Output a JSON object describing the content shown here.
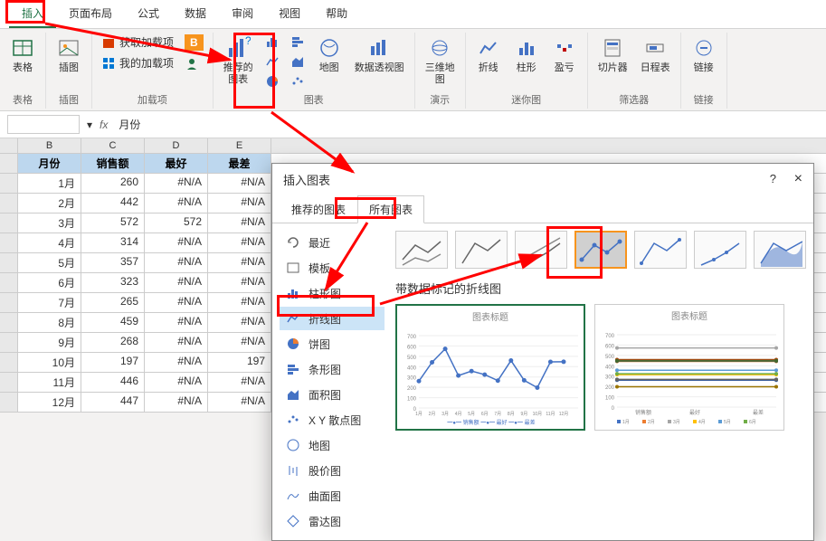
{
  "ribbon": {
    "tabs": [
      "插入",
      "页面布局",
      "公式",
      "数据",
      "审阅",
      "视图",
      "帮助"
    ],
    "active_tab": 0,
    "groups": {
      "tables": {
        "label": "表格",
        "btn": "表格"
      },
      "illustrations": {
        "label": "插图",
        "btn": "插图"
      },
      "addins": {
        "label": "加载项",
        "get": "获取加载项",
        "my": "我的加载项",
        "bing": "B"
      },
      "charts": {
        "label": "图表",
        "recommended": "推荐的\n图表",
        "map": "地图",
        "pivot": "数据透视图"
      },
      "tours": {
        "label": "演示",
        "btn": "三维地\n图"
      },
      "sparklines": {
        "label": "迷你图",
        "line": "折线",
        "column": "柱形",
        "winloss": "盈亏"
      },
      "filters": {
        "label": "筛选器",
        "slicer": "切片器",
        "timeline": "日程表"
      },
      "links": {
        "label": "链接",
        "link": "链接"
      }
    }
  },
  "formula_bar": {
    "fx": "fx",
    "value": "月份"
  },
  "sheet": {
    "cols": [
      "",
      "B",
      "C",
      "D",
      "E"
    ],
    "header_row": [
      "月份",
      "销售额",
      "最好",
      "最差"
    ],
    "rows": [
      [
        "1月",
        "260",
        "#N/A",
        "#N/A"
      ],
      [
        "2月",
        "442",
        "#N/A",
        "#N/A"
      ],
      [
        "3月",
        "572",
        "572",
        "#N/A"
      ],
      [
        "4月",
        "314",
        "#N/A",
        "#N/A"
      ],
      [
        "5月",
        "357",
        "#N/A",
        "#N/A"
      ],
      [
        "6月",
        "323",
        "#N/A",
        "#N/A"
      ],
      [
        "7月",
        "265",
        "#N/A",
        "#N/A"
      ],
      [
        "8月",
        "459",
        "#N/A",
        "#N/A"
      ],
      [
        "9月",
        "268",
        "#N/A",
        "#N/A"
      ],
      [
        "10月",
        "197",
        "#N/A",
        "197"
      ],
      [
        "11月",
        "446",
        "#N/A",
        "#N/A"
      ],
      [
        "12月",
        "447",
        "#N/A",
        "#N/A"
      ]
    ]
  },
  "dialog": {
    "title": "插入图表",
    "help": "?",
    "close": "×",
    "tabs": [
      "推荐的图表",
      "所有图表"
    ],
    "active_tab": 1,
    "chart_types": [
      {
        "icon": "recent",
        "label": "最近"
      },
      {
        "icon": "template",
        "label": "模板"
      },
      {
        "icon": "column",
        "label": "柱形图"
      },
      {
        "icon": "line",
        "label": "折线图"
      },
      {
        "icon": "pie",
        "label": "饼图"
      },
      {
        "icon": "bar",
        "label": "条形图"
      },
      {
        "icon": "area",
        "label": "面积图"
      },
      {
        "icon": "scatter",
        "label": "X Y 散点图"
      },
      {
        "icon": "map",
        "label": "地图"
      },
      {
        "icon": "stock",
        "label": "股价图"
      },
      {
        "icon": "surface",
        "label": "曲面图"
      },
      {
        "icon": "radar",
        "label": "雷达图"
      }
    ],
    "active_type": 3,
    "active_subtype": 3,
    "subtype_title": "带数据标记的折线图",
    "preview_title": "图表标题",
    "legend_items": [
      "销售额",
      "最好",
      "最差"
    ],
    "months_legend": [
      "1月",
      "2月",
      "3月",
      "4月",
      "5月",
      "6月",
      "7月",
      "8月",
      "9月",
      "10月",
      "11月",
      "12月"
    ]
  },
  "chart_data": {
    "type": "line",
    "title": "图表标题",
    "categories": [
      "1月",
      "2月",
      "3月",
      "4月",
      "5月",
      "6月",
      "7月",
      "8月",
      "9月",
      "10月",
      "11月",
      "12月"
    ],
    "series": [
      {
        "name": "销售额",
        "values": [
          260,
          442,
          572,
          314,
          357,
          323,
          265,
          459,
          268,
          197,
          446,
          447
        ]
      },
      {
        "name": "最好",
        "values": [
          null,
          null,
          572,
          null,
          null,
          null,
          null,
          null,
          null,
          null,
          null,
          null
        ]
      },
      {
        "name": "最差",
        "values": [
          null,
          null,
          null,
          null,
          null,
          null,
          null,
          null,
          null,
          197,
          null,
          null
        ]
      }
    ],
    "ylim": [
      0,
      700
    ],
    "xlabel": "",
    "ylabel": ""
  }
}
